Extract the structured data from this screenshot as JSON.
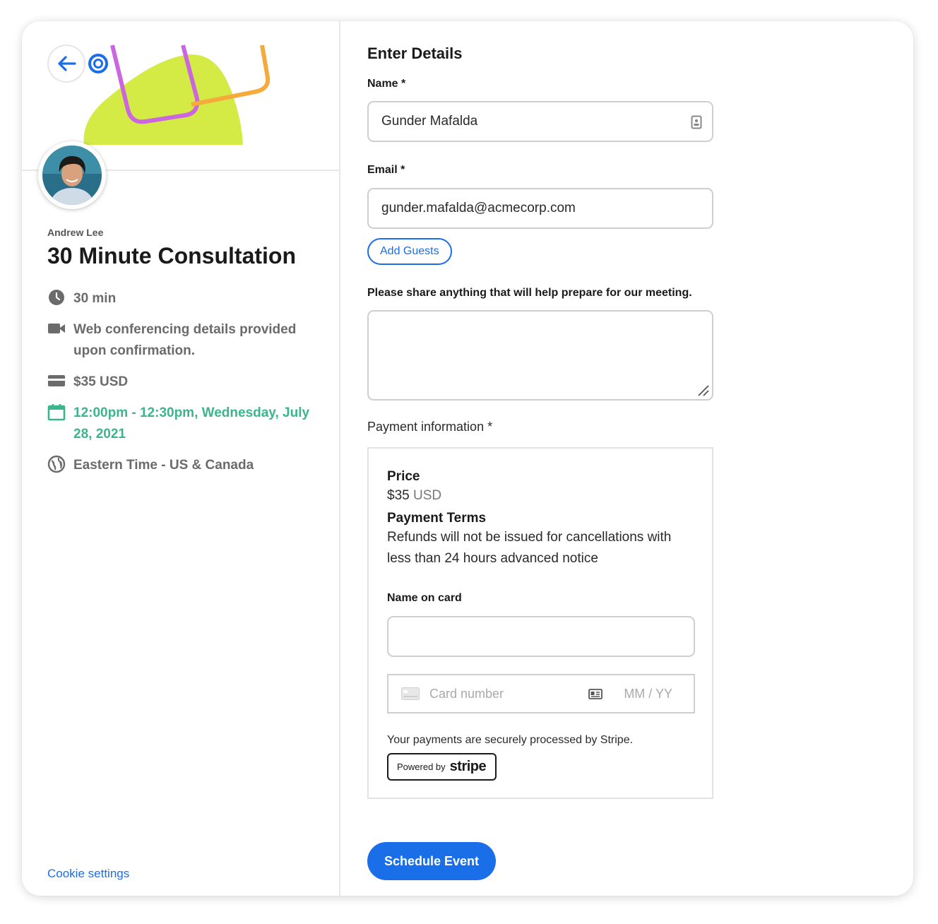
{
  "event": {
    "host": "Andrew Lee",
    "title": "30 Minute Consultation",
    "duration": "30 min",
    "conferencing": "Web conferencing details provided upon confirmation.",
    "price": "$35 USD",
    "datetime": "12:00pm - 12:30pm, Wednesday, July 28, 2021",
    "timezone": "Eastern Time - US & Canada"
  },
  "footer": {
    "cookie_settings": "Cookie settings"
  },
  "form": {
    "section_title": "Enter Details",
    "name_label": "Name *",
    "name_value": "Gunder Mafalda",
    "email_label": "Email *",
    "email_value": "gunder.mafalda@acmecorp.com",
    "add_guests": "Add Guests",
    "notes_label": "Please share anything that will help prepare for our meeting.",
    "notes_value": ""
  },
  "payment": {
    "label": "Payment information *",
    "price_heading": "Price",
    "price_amount": "$35",
    "price_unit": "USD",
    "terms_heading": "Payment Terms",
    "terms_text": "Refunds will not be issued for cancellations with less than 24 hours advanced notice",
    "name_on_card_label": "Name on card",
    "name_on_card_value": "",
    "card_number_placeholder": "Card number",
    "expiry_placeholder": "MM / YY",
    "stripe_note": "Your payments are securely processed by Stripe.",
    "powered_by": "Powered by",
    "stripe_wordmark": "stripe"
  },
  "actions": {
    "schedule": "Schedule Event"
  },
  "colors": {
    "accent": "#1a6ee8",
    "date_green": "#3cb48c",
    "art_lime": "#d4ea45",
    "art_purple": "#cc66e0",
    "art_orange": "#f5aa3c"
  },
  "icons": [
    "back-arrow-icon",
    "calendly-logo-icon",
    "clock-icon",
    "video-icon",
    "card-icon",
    "calendar-icon",
    "globe-icon",
    "contact-card-icon",
    "resize-grip-icon",
    "credit-card-icon",
    "cvc-card-icon"
  ]
}
